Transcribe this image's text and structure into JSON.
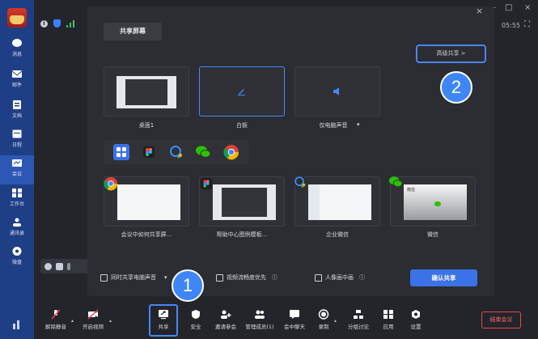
{
  "window": {
    "minimize": "—",
    "maximize": "□",
    "close": "×",
    "clock": "05:55",
    "fullscreen": "⛶"
  },
  "sidebar": {
    "items": [
      {
        "label": "消息",
        "icon": "chat-icon"
      },
      {
        "label": "邮件",
        "icon": "mail-icon"
      },
      {
        "label": "文档",
        "icon": "doc-icon"
      },
      {
        "label": "日程",
        "icon": "calendar-icon"
      },
      {
        "label": "会议",
        "icon": "meeting-icon"
      },
      {
        "label": "工作台",
        "icon": "grid-icon"
      },
      {
        "label": "通讯录",
        "icon": "contacts-icon"
      },
      {
        "label": "微盘",
        "icon": "drive-icon"
      }
    ]
  },
  "status": {
    "info": "i"
  },
  "dialog": {
    "close": "×",
    "title": "共享屏幕",
    "advanced_share": "高级共享 >",
    "top_tiles": [
      {
        "label": "桌面1"
      },
      {
        "label": "白板"
      },
      {
        "label": "仅电脑声音",
        "caret": "▾"
      }
    ],
    "apps": [
      {
        "label": "会议中如何共享屏..."
      },
      {
        "label": "帮助中心图例模板..."
      },
      {
        "label": "企业微信"
      },
      {
        "label": "微信"
      }
    ],
    "options": {
      "share_audio": "同时共享电脑声音",
      "audio_caret": "▾",
      "smooth_video": "视频流畅度优先",
      "pip": "人像画中画",
      "info_mark": "ⓘ"
    },
    "confirm": "确认共享",
    "wechat_window_title": "微信"
  },
  "annotations": {
    "one": "1",
    "two": "2"
  },
  "toolbar": {
    "items": [
      {
        "label": "解除静音",
        "icon": "mic-muted-icon"
      },
      {
        "label": "开启视频",
        "icon": "camera-off-icon"
      },
      {
        "label": "共享",
        "icon": "share-screen-icon"
      },
      {
        "label": "安全",
        "icon": "shield-icon"
      },
      {
        "label": "邀请参会",
        "icon": "invite-icon"
      },
      {
        "label": "管理成员(1)",
        "icon": "members-icon"
      },
      {
        "label": "会中聊天",
        "icon": "chat-icon"
      },
      {
        "label": "录制",
        "icon": "record-icon"
      },
      {
        "label": "分组讨论",
        "icon": "breakout-icon"
      },
      {
        "label": "应用",
        "icon": "apps-icon"
      },
      {
        "label": "设置",
        "icon": "settings-icon"
      }
    ],
    "caret": "▴",
    "end_meeting": "结束会议"
  },
  "colors": {
    "accent": "#3b72e8",
    "highlight": "#4a86f7",
    "danger": "#e5484d",
    "sidebar": "#1e3f86"
  }
}
